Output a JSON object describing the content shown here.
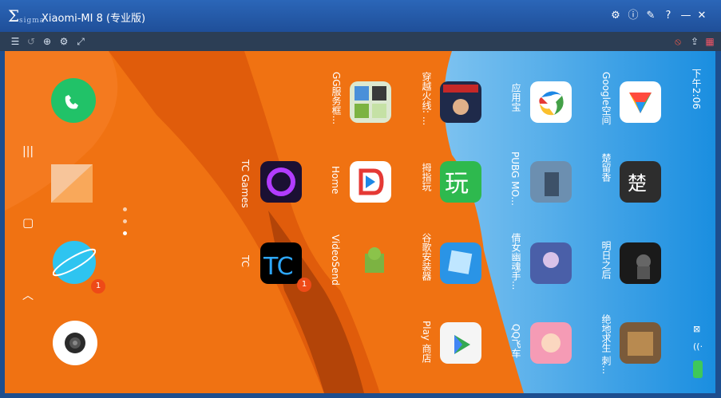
{
  "window": {
    "logo_text": "Σ",
    "logo_sub": "sigma",
    "title": "Xiaomi-MI 8 (专业版)",
    "controls": [
      "gear-icon",
      "info-icon",
      "pin-icon",
      "help-icon",
      "minimize-icon",
      "close-icon"
    ]
  },
  "toolbar": {
    "left": [
      "list-icon",
      "rotate-icon",
      "zoom-icon",
      "settings-icon",
      "fullscreen-icon"
    ],
    "right": [
      "mute-icon",
      "export-icon",
      "grid-icon"
    ]
  },
  "phone": {
    "time": "下午2:06",
    "apps": [
      {
        "label": "Google空间",
        "name": "google-space"
      },
      {
        "label": "应用宝",
        "name": "yingyongbao"
      },
      {
        "label": "穿越火线: ...",
        "name": "crossfire"
      },
      {
        "label": "GG服务框...",
        "name": "gg-service"
      },
      {
        "label": "楚留香",
        "name": "chuliuxiang"
      },
      {
        "label": "PUBG MO...",
        "name": "pubg-mobile"
      },
      {
        "label": "拇指玩",
        "name": "muzhiwan"
      },
      {
        "label": "Home",
        "name": "home"
      },
      {
        "label": "TC Games",
        "name": "tc-games"
      },
      {
        "label": "明日之后",
        "name": "mingrizhihou"
      },
      {
        "label": "倩女幽魂手...",
        "name": "qiannvyouhun"
      },
      {
        "label": "谷歌安装器",
        "name": "google-installer"
      },
      {
        "label": "VideoSend",
        "name": "videosend"
      },
      {
        "label": "TC",
        "name": "tc"
      },
      {
        "label": "绝地求生 刺...",
        "name": "jedi-survival"
      },
      {
        "label": "QQ飞车",
        "name": "qq-speed"
      },
      {
        "label": "Play 商店",
        "name": "play-store"
      }
    ],
    "badges": {
      "tc": "1",
      "browser": "1"
    }
  }
}
